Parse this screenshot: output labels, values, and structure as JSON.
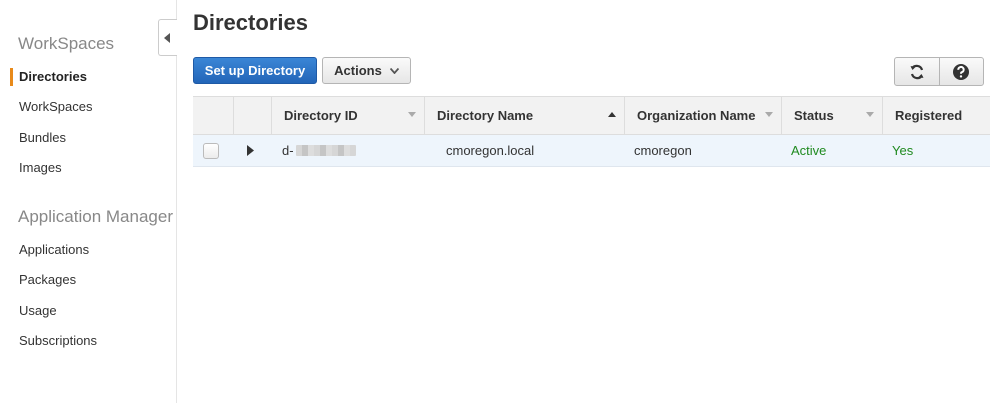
{
  "sidebar": {
    "section1": "WorkSpaces",
    "items1": [
      {
        "label": "Directories"
      },
      {
        "label": "WorkSpaces"
      },
      {
        "label": "Bundles"
      },
      {
        "label": "Images"
      }
    ],
    "section2": "Application Manager",
    "items2": [
      {
        "label": "Applications"
      },
      {
        "label": "Packages"
      },
      {
        "label": "Usage"
      },
      {
        "label": "Subscriptions"
      }
    ]
  },
  "page": {
    "title": "Directories"
  },
  "toolbar": {
    "setup_label": "Set up Directory",
    "actions_label": "Actions",
    "refresh_icon": "refresh-icon",
    "help_icon": "help-icon"
  },
  "table": {
    "columns": [
      "Directory ID",
      "Directory Name",
      "Organization Name",
      "Status",
      "Registered"
    ],
    "rows": [
      {
        "directory_id": "d-",
        "directory_name": "cmoregon.local",
        "organization_name": "cmoregon",
        "status": "Active",
        "registered": "Yes"
      }
    ]
  },
  "colors": {
    "accent": "#e88a1a",
    "primary": "#2a72c8",
    "status_ok": "#1f8a1f",
    "row_selected": "#eef5fc"
  }
}
